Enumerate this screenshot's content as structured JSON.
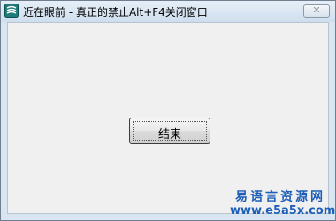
{
  "window": {
    "title": "近在眼前 - 真正的禁止Alt+F4关闭窗口",
    "icon": "e-language-app-icon",
    "close_glyph": "✕"
  },
  "dialog": {
    "end_button_label": "结束"
  },
  "watermark": {
    "line1": "易语言资源网",
    "line2": "www.e5a5x.com"
  },
  "colors": {
    "client_bg": "#f0f0f0",
    "title_bar": "#d9e6f2",
    "watermark": "#1e5fb8"
  }
}
